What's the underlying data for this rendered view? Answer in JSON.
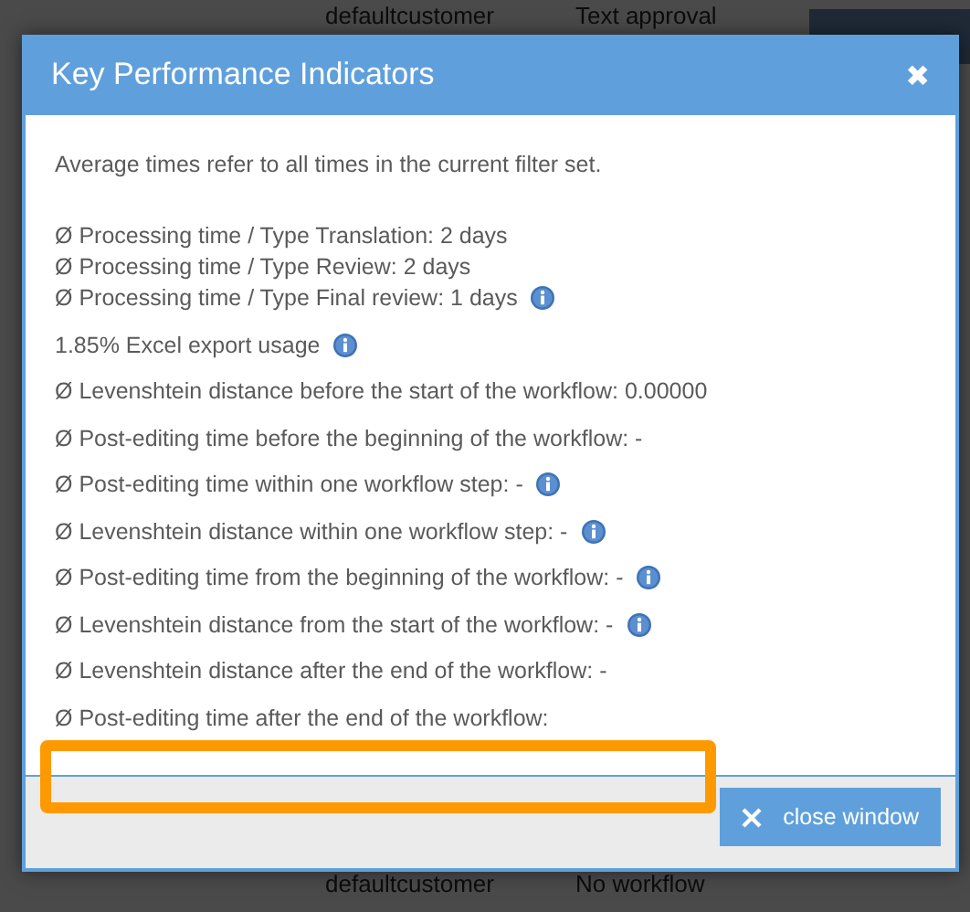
{
  "background_rows": [
    {
      "customer": "defaultcustomer",
      "workflow": "Text approval"
    },
    {
      "customer": "defaultcustomer",
      "workflow": "No workflow"
    }
  ],
  "dialog": {
    "title": "Key Performance Indicators",
    "close_symbol": "✖",
    "sections": [
      {
        "lines": [
          {
            "text": "Average times refer to all times in the current filter set.",
            "info": false
          }
        ]
      },
      {
        "lines": [
          {
            "text": "Ø Processing time / Type Translation: 2 days",
            "info": false
          },
          {
            "text": "Ø Processing time / Type Review: 2 days",
            "info": false
          },
          {
            "text": "Ø Processing time / Type Final review: 1 days",
            "info": true
          }
        ]
      },
      {
        "lines": [
          {
            "text": "1.85% Excel export usage",
            "info": true
          }
        ]
      },
      {
        "lines": [
          {
            "text": "Ø Levenshtein distance before the start of the workflow: 0.00000",
            "info": false
          }
        ]
      },
      {
        "lines": [
          {
            "text": "Ø Post-editing time before the beginning of the workflow: -",
            "info": false
          }
        ]
      },
      {
        "lines": [
          {
            "text": "Ø Post-editing time within one workflow step: -",
            "info": true
          }
        ]
      },
      {
        "lines": [
          {
            "text": "Ø Levenshtein distance within one workflow step: -",
            "info": true
          }
        ]
      },
      {
        "lines": [
          {
            "text": "Ø Post-editing time from the beginning of the workflow: -",
            "info": true
          }
        ]
      },
      {
        "lines": [
          {
            "text": "Ø Levenshtein distance from the start of the workflow: -",
            "info": true
          }
        ]
      },
      {
        "lines": [
          {
            "text": "Ø Levenshtein distance after the end of the workflow: -",
            "info": false
          }
        ]
      },
      {
        "lines": [
          {
            "text": "Ø Post-editing time after the end of the workflow:",
            "info": false
          }
        ]
      }
    ],
    "close_button": "close window"
  }
}
